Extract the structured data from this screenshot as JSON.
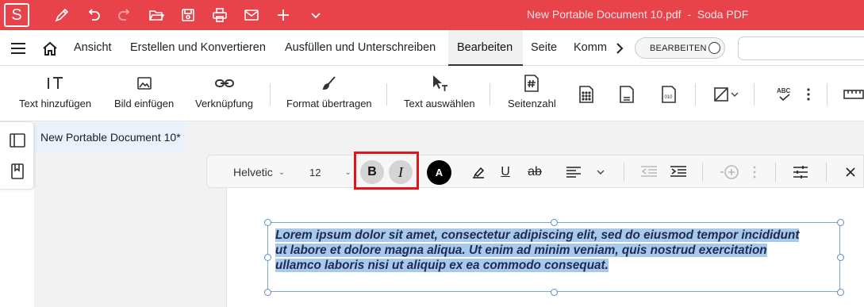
{
  "app": {
    "logo_letter": "S",
    "window_title": "New Portable Document 10.pdf  -  Soda PDF",
    "accent_color": "#e8424a"
  },
  "quick_access": [
    "pen-icon",
    "undo-icon",
    "redo-icon",
    "open-folder-icon",
    "save-icon",
    "print-icon",
    "mail-icon",
    "new-icon",
    "more-chevron-icon"
  ],
  "menu": {
    "tabs": [
      {
        "label": "Ansicht"
      },
      {
        "label": "Erstellen und Konvertieren"
      },
      {
        "label": "Ausfüllen und Unterschreiben"
      },
      {
        "label": "Bearbeiten",
        "active": true
      },
      {
        "label": "Seite"
      },
      {
        "label": "Komm"
      }
    ],
    "mode_label": "BEARBEITEN"
  },
  "ribbon": {
    "add_text": "Text hinzufügen",
    "add_image": "Bild einfügen",
    "link": "Verknüpfung",
    "format_painter": "Format übertragen",
    "select_text": "Text auswählen",
    "page_number": "Seitenzahl"
  },
  "document": {
    "tab_title": "New Portable Document 10*",
    "text_line1": "Lorem ipsum dolor sit amet, consectetur adipiscing elit, sed do eiusmod tempor incididunt",
    "text_line2": "ut labore et dolore magna aliqua. Ut enim ad minim veniam, quis nostrud exercitation",
    "text_line3": "ullamco laboris nisi ut aliquip ex ea commodo consequat.",
    "text_color": "#1d2a52",
    "selection_color": "#a9c9ea"
  },
  "format_toolbar": {
    "font": "Helvetic",
    "size": "12",
    "bold": "B",
    "italic": "I",
    "color_label": "A",
    "highlight_color": "#e2131b"
  }
}
